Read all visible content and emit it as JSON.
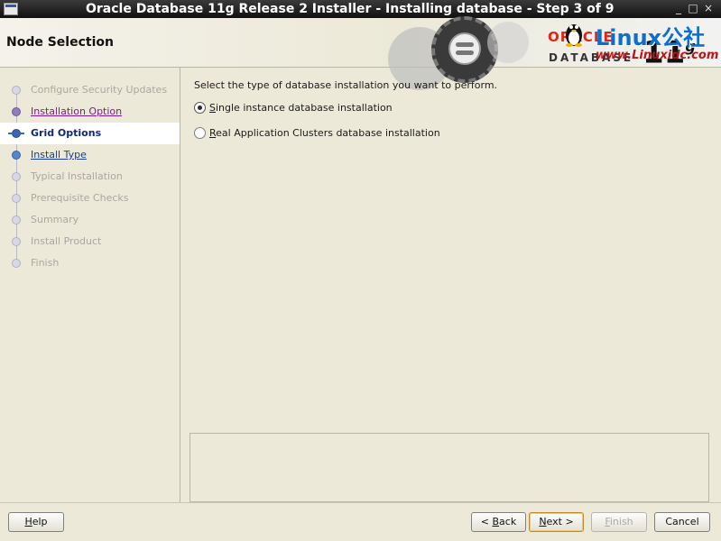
{
  "window": {
    "title": "Oracle Database 11g Release 2 Installer - Installing database - Step 3 of 9",
    "controls": [
      "_",
      "□",
      "×"
    ]
  },
  "header": {
    "page_title": "Node Selection",
    "brand_oracle": "ORACLE",
    "brand_database": "DATABASE",
    "brand_version": "11",
    "brand_version_suffix": "g",
    "watermark_linux": "Linux公社",
    "watermark_url": "www.Linuxidc.com"
  },
  "sidebar": {
    "steps": [
      {
        "label": "Configure Security Updates",
        "state": "disabled"
      },
      {
        "label": "Installation Option",
        "state": "visited"
      },
      {
        "label": "Grid Options",
        "state": "current"
      },
      {
        "label": "Install Type",
        "state": "link"
      },
      {
        "label": "Typical Installation",
        "state": "disabled"
      },
      {
        "label": "Prerequisite Checks",
        "state": "disabled"
      },
      {
        "label": "Summary",
        "state": "disabled"
      },
      {
        "label": "Install Product",
        "state": "disabled"
      },
      {
        "label": "Finish",
        "state": "disabled"
      }
    ]
  },
  "main": {
    "prompt": "Select the type of database installation you want to perform.",
    "options": [
      {
        "mnemonic": "S",
        "rest": "ingle instance database installation",
        "selected": true
      },
      {
        "mnemonic": "R",
        "rest": "eal Application Clusters database installation",
        "selected": false
      }
    ]
  },
  "footer": {
    "help": {
      "mnemonic": "H",
      "rest": "elp"
    },
    "back": {
      "prefix": "< ",
      "mnemonic": "B",
      "rest": "ack"
    },
    "next": {
      "mnemonic": "N",
      "rest": "ext >"
    },
    "finish": {
      "mnemonic": "F",
      "rest": "inish",
      "enabled": false
    },
    "cancel": {
      "label": "Cancel"
    }
  }
}
